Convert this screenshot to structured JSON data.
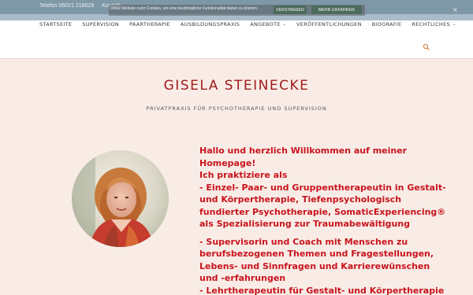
{
  "topbar": {
    "phone": "Telefon 06021 218029",
    "contact": "Kontakt"
  },
  "cookie": {
    "text": "Diese Website nutzt Cookies, um eine bestmögliche Funktionalität bieten zu können.",
    "accept": "VERSTANDEN",
    "more": "MEHR ERFAHREN",
    "close": "×"
  },
  "nav": {
    "items": [
      {
        "label": "STARTSEITE"
      },
      {
        "label": "SUPERVISION"
      },
      {
        "label": "PAARTHERAPIE"
      },
      {
        "label": "AUSBILDUNGSPRAXIS"
      },
      {
        "label": "ANGEBOTE",
        "chevron": "⌄"
      },
      {
        "label": "VERÖFFENTLICHUNGEN"
      },
      {
        "label": "BIOGRAFIE"
      },
      {
        "label": "RECHTLICHES",
        "chevron": "⌄"
      }
    ],
    "search_icon": "search-icon"
  },
  "header": {
    "title": "GISELA STEINECKE",
    "tagline": "PRIVATPRAXIS FÜR PSYCHOTHERAPIE UND SUPERVISION"
  },
  "content": {
    "para1": [
      "Hallo und herzlich Willkommen auf meiner",
      "Homepage!",
      "Ich praktiziere als",
      "- Einzel- Paar- und Gruppentherapeutin in Gestalt-",
      "und Körpertherapie, Tiefenpsychologisch",
      "fundierter Psychotherapie, SomaticExperiencing®",
      "als Spezialisierung zur Traumabewältigung"
    ],
    "para2": [
      "- Supervisorin und Coach mit Menschen zu",
      "berufsbezogenen Themen und Fragestellungen,",
      "Lebens- und Sinnfragen und Karrierewünschen",
      "und -erfahrungen",
      "- Lehrtherapeutin für Gestalt- und Körpertherapie"
    ]
  },
  "colors": {
    "accent": "#9e1b1b",
    "text_red": "#c8141e",
    "background": "#f9ece6",
    "topbar": "#7f98a8"
  }
}
